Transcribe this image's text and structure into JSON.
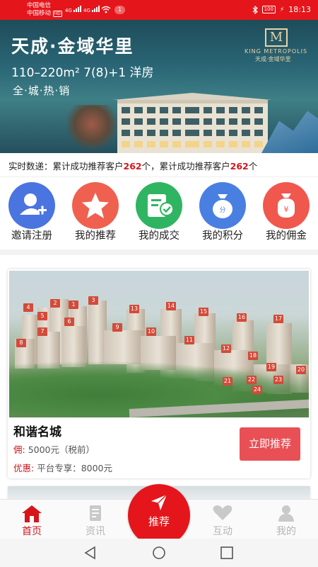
{
  "status_bar": {
    "carrier1": "中国电信",
    "carrier2": "中国移动",
    "hd": "HD",
    "net1": "4G",
    "net2": "4G",
    "notif_count": "1",
    "battery": "100",
    "time": "18:13"
  },
  "banner": {
    "title": "天成·金域华里",
    "subtitle": "110–220m²  7(8)+1 洋房",
    "tagline": "全·城·热·销",
    "logo_mark": "M",
    "logo_en": "KING METROPOLIS",
    "logo_cn": "天成·金域华里"
  },
  "ticker": {
    "prefix": "实时数递：",
    "seg1_pre": "累计成功推荐客户",
    "seg1_num": "262",
    "seg1_post": "个，",
    "seg2_pre": "累计成功推荐客户",
    "seg2_num": "262",
    "seg2_post": "个"
  },
  "nav": [
    {
      "label": "邀请注册",
      "icon": "add-user-icon",
      "color": "#4a74e0"
    },
    {
      "label": "我的推荐",
      "icon": "star-icon",
      "color": "#f0604f"
    },
    {
      "label": "我的成交",
      "icon": "deal-check-icon",
      "color": "#2fb562"
    },
    {
      "label": "我的积分",
      "icon": "points-bag-icon",
      "color": "#4a7fe2"
    },
    {
      "label": "我的佣金",
      "icon": "commission-bag-icon",
      "color": "#f0584d"
    }
  ],
  "property": {
    "name": "和谐名城",
    "commission_label": "佣:",
    "commission_value": "5000元（税前）",
    "discount_label": "优惠:",
    "discount_value": "平台专享：8000元",
    "action": "立即推荐",
    "building_numbers": [
      "4",
      "2",
      "1",
      "3",
      "5",
      "6",
      "7",
      "8",
      "9",
      "10",
      "11",
      "12",
      "13",
      "14",
      "15",
      "16",
      "17",
      "18",
      "19",
      "20",
      "21",
      "22",
      "23",
      "24"
    ]
  },
  "tabs": [
    {
      "label": "首页",
      "icon": "home-icon"
    },
    {
      "label": "资讯",
      "icon": "news-icon"
    },
    {
      "label": "推荐",
      "icon": "send-icon"
    },
    {
      "label": "互动",
      "icon": "heart-icon"
    },
    {
      "label": "我的",
      "icon": "user-icon"
    }
  ],
  "colors": {
    "brand": "#e4161b",
    "accent_text": "#d6151b",
    "button": "#e85056"
  }
}
